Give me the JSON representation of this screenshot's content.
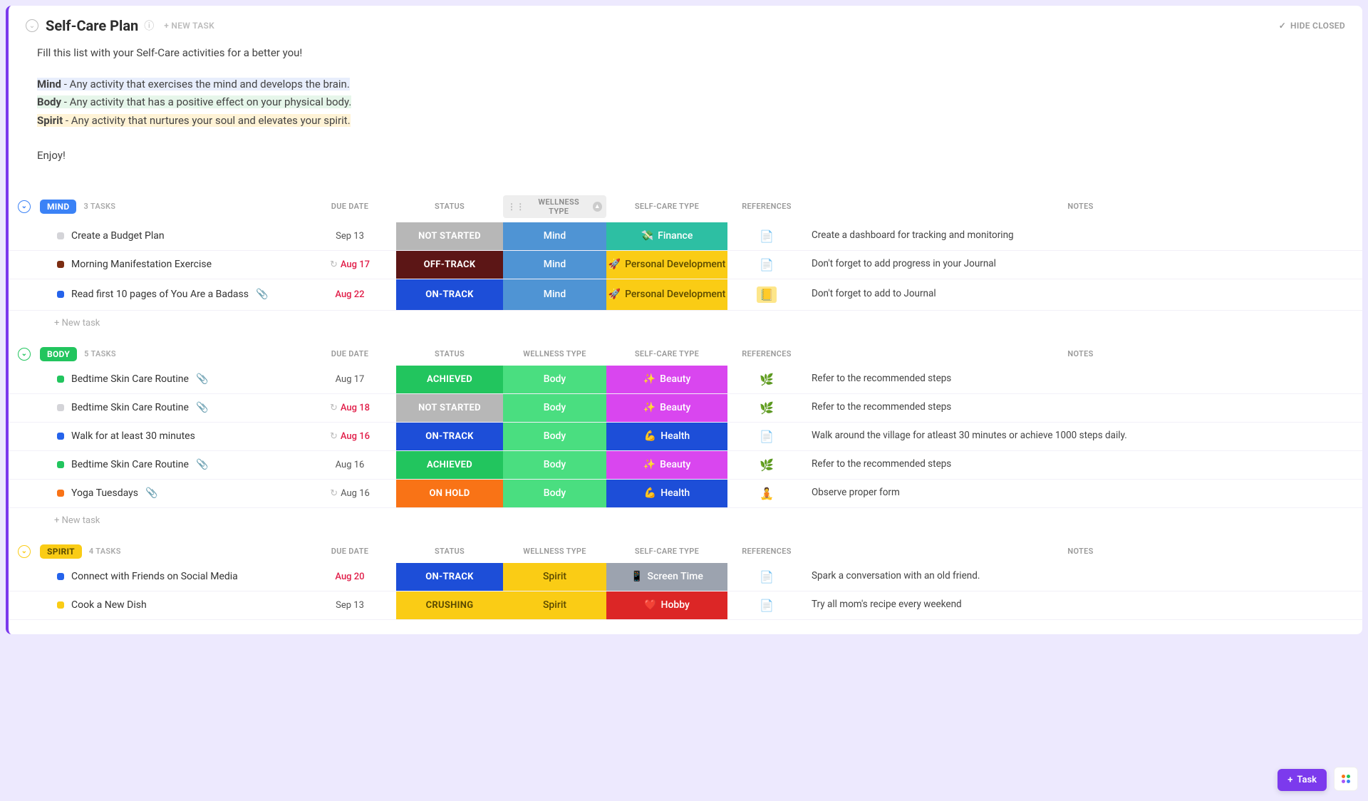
{
  "header": {
    "title": "Self-Care Plan",
    "new_task": "+ NEW TASK",
    "hide_closed": "HIDE CLOSED"
  },
  "description": {
    "intro": "Fill this list with your Self-Care activities for a better you!",
    "mind_label": "Mind",
    "mind_text": " - Any activity that exercises the mind and develops the brain.",
    "body_label": "Body",
    "body_text": " - Any activity that has a positive effect on your physical body.",
    "spirit_label": "Spirit",
    "spirit_text": " - Any activity that nurtures your soul and elevates your spirit.",
    "enjoy": "Enjoy!"
  },
  "columns": {
    "due": "DUE DATE",
    "status": "STATUS",
    "wellness": "WELLNESS TYPE",
    "care": "SELF-CARE TYPE",
    "refs": "REFERENCES",
    "notes": "NOTES"
  },
  "groups": [
    {
      "id": "mind",
      "label": "Mind",
      "count": "3 TASKS",
      "color": "#3b82f6",
      "wellness_active": true,
      "rows": [
        {
          "dot": "dot-gray",
          "name": "Create a Budget Plan",
          "clip": false,
          "recur": false,
          "due": "Sep 13",
          "due_red": false,
          "status": "NOT STARTED",
          "status_cls": "status-notstarted",
          "well": "Mind",
          "well_cls": "well-mind",
          "care": "Finance",
          "care_emoji": "💸",
          "care_cls": "care-finance",
          "ref": "doc",
          "notes": "Create a dashboard for tracking and monitoring"
        },
        {
          "dot": "dot-brown",
          "name": "Morning Manifestation Exercise",
          "clip": false,
          "recur": true,
          "due": "Aug 17",
          "due_red": true,
          "status": "OFF-TRACK",
          "status_cls": "status-offtrack",
          "well": "Mind",
          "well_cls": "well-mind",
          "care": "Personal Development",
          "care_emoji": "🚀",
          "care_cls": "care-pd",
          "ref": "doc",
          "notes": "Don't forget to add progress in your Journal"
        },
        {
          "dot": "dot-blue",
          "name": "Read first 10 pages of You Are a Badass",
          "clip": true,
          "recur": false,
          "due": "Aug 22",
          "due_red": true,
          "status": "ON-TRACK",
          "status_cls": "status-ontrack",
          "well": "Mind",
          "well_cls": "well-mind",
          "care": "Personal Development",
          "care_emoji": "🚀",
          "care_cls": "care-pd",
          "ref": "note",
          "notes": "Don't forget to add to Journal"
        }
      ]
    },
    {
      "id": "body",
      "label": "Body",
      "count": "5 TASKS",
      "color": "#22c55e",
      "wellness_active": false,
      "rows": [
        {
          "dot": "dot-green",
          "name": "Bedtime Skin Care Routine",
          "clip": true,
          "recur": false,
          "due": "Aug 17",
          "due_red": false,
          "status": "ACHIEVED",
          "status_cls": "status-achieved",
          "well": "Body",
          "well_cls": "well-body",
          "care": "Beauty",
          "care_emoji": "✨",
          "care_cls": "care-beauty",
          "ref": "emoji",
          "ref_emoji": "🌿",
          "notes": "Refer to the recommended steps"
        },
        {
          "dot": "dot-gray",
          "name": "Bedtime Skin Care Routine",
          "clip": true,
          "recur": true,
          "due": "Aug 18",
          "due_red": true,
          "status": "NOT STARTED",
          "status_cls": "status-notstarted",
          "well": "Body",
          "well_cls": "well-body",
          "care": "Beauty",
          "care_emoji": "✨",
          "care_cls": "care-beauty",
          "ref": "emoji",
          "ref_emoji": "🌿",
          "notes": "Refer to the recommended steps"
        },
        {
          "dot": "dot-blue",
          "name": "Walk for at least 30 minutes",
          "clip": false,
          "recur": true,
          "due": "Aug 16",
          "due_red": true,
          "status": "ON-TRACK",
          "status_cls": "status-ontrack",
          "well": "Body",
          "well_cls": "well-body",
          "care": "Health",
          "care_emoji": "💪",
          "care_cls": "care-health",
          "ref": "doc",
          "notes": "Walk around the village for atleast 30 minutes or achieve 1000 steps daily."
        },
        {
          "dot": "dot-green",
          "name": "Bedtime Skin Care Routine",
          "clip": true,
          "recur": false,
          "due": "Aug 16",
          "due_red": false,
          "status": "ACHIEVED",
          "status_cls": "status-achieved",
          "well": "Body",
          "well_cls": "well-body",
          "care": "Beauty",
          "care_emoji": "✨",
          "care_cls": "care-beauty",
          "ref": "emoji",
          "ref_emoji": "🌿",
          "notes": "Refer to the recommended steps"
        },
        {
          "dot": "dot-orange",
          "name": "Yoga Tuesdays",
          "clip": true,
          "recur": true,
          "due": "Aug 16",
          "due_red": false,
          "status": "ON HOLD",
          "status_cls": "status-onhold",
          "well": "Body",
          "well_cls": "well-body",
          "care": "Health",
          "care_emoji": "💪",
          "care_cls": "care-health",
          "ref": "emoji",
          "ref_emoji": "🧘",
          "notes": "Observe proper form"
        }
      ]
    },
    {
      "id": "spirit",
      "label": "Spirit",
      "count": "4 TASKS",
      "color": "#facc15",
      "wellness_active": false,
      "rows": [
        {
          "dot": "dot-blue",
          "name": "Connect with Friends on Social Media",
          "clip": false,
          "recur": false,
          "due": "Aug 20",
          "due_red": true,
          "status": "ON-TRACK",
          "status_cls": "status-ontrack",
          "well": "Spirit",
          "well_cls": "well-spirit",
          "care": "Screen Time",
          "care_emoji": "📱",
          "care_cls": "care-screen",
          "ref": "doc",
          "notes": "Spark a conversation with an old friend."
        },
        {
          "dot": "dot-yellow",
          "name": "Cook a New Dish",
          "clip": false,
          "recur": false,
          "due": "Sep 13",
          "due_red": false,
          "status": "CRUSHING",
          "status_cls": "status-crushing",
          "well": "Spirit",
          "well_cls": "well-spirit",
          "care": "Hobby",
          "care_emoji": "❤️",
          "care_cls": "care-hobby",
          "ref": "doc",
          "notes": "Try all mom's recipe every weekend"
        }
      ]
    }
  ],
  "new_task_row": "+ New task",
  "float": {
    "task": "Task"
  }
}
